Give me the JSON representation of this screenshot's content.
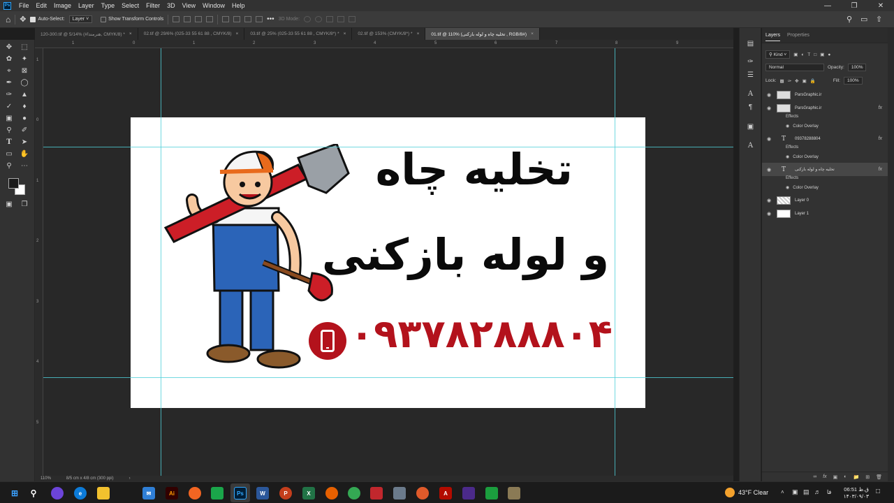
{
  "app": {
    "logo_text": "Ps"
  },
  "menu": [
    "File",
    "Edit",
    "Image",
    "Layer",
    "Type",
    "Select",
    "Filter",
    "3D",
    "View",
    "Window",
    "Help"
  ],
  "options_bar": {
    "auto_select_label": "Auto-Select:",
    "auto_select_value": "Layer",
    "show_transform_label": "Show Transform Controls",
    "mode_3d_label": "3D Mode:",
    "more_label": "•••"
  },
  "tabs": [
    {
      "label": "120-300.tif @ 5/14% (#هنرمندا, CMYK/8) *",
      "active": false
    },
    {
      "label": "02.tif @ 29/6% (025-33 55 61 88 , CMYK/8)",
      "active": false
    },
    {
      "label": "03.tif @ 25% (025-33 55 61 88 , CMYK/8*) *",
      "active": false
    },
    {
      "label": "02.tif @ 153% (CMYK/8*) *",
      "active": false
    },
    {
      "label": "01.tif @ 110% (تخلیه چاه و لوله بازکنی , RGB/8#)",
      "active": true
    }
  ],
  "ruler": {
    "top": [
      "1",
      "0",
      "1",
      "2",
      "3",
      "4",
      "5",
      "6",
      "7",
      "8",
      "9"
    ],
    "left": [
      "1",
      "0",
      "1",
      "2",
      "3",
      "4",
      "5"
    ]
  },
  "poster": {
    "line1": "تخلیه چاه",
    "line2": "و لوله بازکنی",
    "phone": "۰۹۳۷۸۲۸۸۸۰۴",
    "brand_red": "#b3121c"
  },
  "status": {
    "zoom": "110%",
    "doc_size": "8/5 cm x 4/8 cm (300 ppi)"
  },
  "layers_panel": {
    "tab_layers": "Layers",
    "tab_properties": "Properties",
    "kind_label": "Kind",
    "blend_mode": "Normal",
    "opacity_label": "Opacity:",
    "opacity_value": "100%",
    "lock_label": "Lock:",
    "fill_label": "Fill:",
    "fill_value": "100%",
    "effects_label": "Effects",
    "color_overlay_label": "Color Overlay",
    "layers": [
      {
        "name": "ParsGraphic.ir",
        "kind": "image",
        "fx": false
      },
      {
        "name": "ParsGraphic.ir",
        "kind": "image",
        "fx": true
      },
      {
        "name": "09378288804",
        "kind": "text",
        "fx": true
      },
      {
        "name": "تخلیه چاه  و لوله بازکنی",
        "kind": "text",
        "fx": true
      },
      {
        "name": "Layer 0",
        "kind": "image",
        "fx": false
      },
      {
        "name": "Layer 1",
        "kind": "white",
        "fx": false
      }
    ]
  },
  "taskbar": {
    "weather": "43°F  Clear",
    "time": "06:51 ق.ظ",
    "date": "۱۴۰۳/۰۹/۰۳",
    "lang": "فا"
  }
}
